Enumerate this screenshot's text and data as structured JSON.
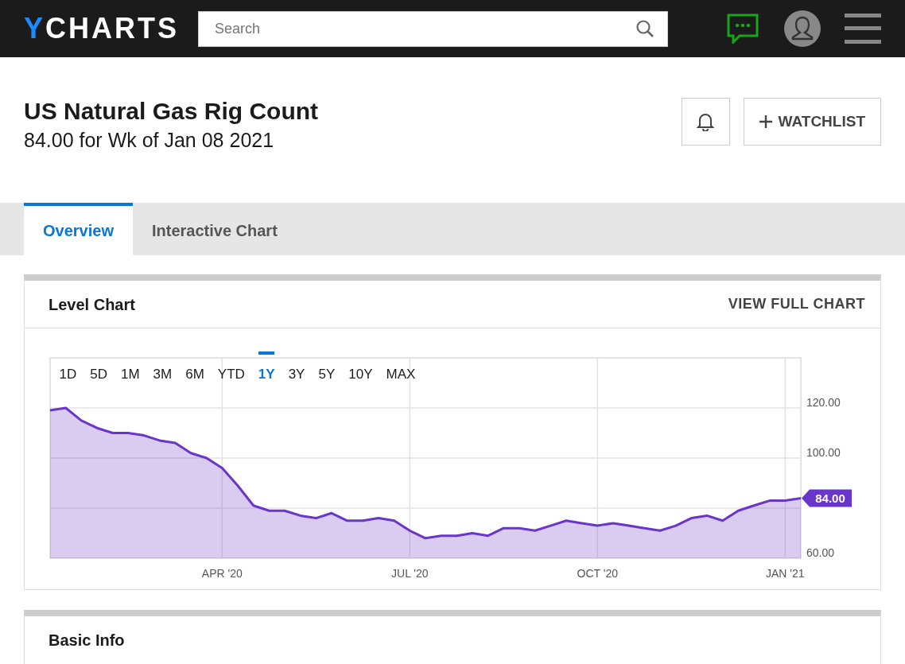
{
  "navbar": {
    "logo": "YCHARTS",
    "search": {
      "placeholder": "Search"
    }
  },
  "header": {
    "title": "US Natural Gas Rig Count",
    "subtitle": "84.00 for Wk of Jan 08 2021",
    "watchlist_button": "WATCHLIST"
  },
  "tabs": [
    {
      "label": "Overview",
      "selected": true
    },
    {
      "label": "Interactive Chart",
      "selected": false
    }
  ],
  "level_chart": {
    "title": "Level Chart",
    "link": "VIEW FULL CHART",
    "ranges": [
      {
        "label": "1D",
        "selected": false
      },
      {
        "label": "5D",
        "selected": false
      },
      {
        "label": "1M",
        "selected": false
      },
      {
        "label": "3M",
        "selected": false
      },
      {
        "label": "6M",
        "selected": false
      },
      {
        "label": "YTD",
        "selected": false
      },
      {
        "label": "1Y",
        "selected": true
      },
      {
        "label": "3Y",
        "selected": false
      },
      {
        "label": "5Y",
        "selected": false
      },
      {
        "label": "10Y",
        "selected": false
      },
      {
        "label": "MAX",
        "selected": false
      }
    ],
    "current_value_tag": "84.00",
    "chart_data": {
      "type": "area",
      "categories": [
        null,
        null,
        null,
        null,
        null,
        null,
        null,
        null,
        null,
        null,
        null,
        "APR '20",
        null,
        null,
        null,
        null,
        null,
        null,
        null,
        null,
        null,
        null,
        null,
        "JUL '20",
        null,
        null,
        null,
        null,
        null,
        null,
        null,
        null,
        null,
        null,
        null,
        "OCT '20",
        null,
        null,
        null,
        null,
        null,
        null,
        null,
        null,
        null,
        null,
        null,
        "JAN '21",
        null
      ],
      "grid": true,
      "series": [
        {
          "color": "#6a35c9",
          "values": [
            119,
            120,
            115,
            112,
            110,
            110,
            109,
            107,
            106,
            102,
            100,
            96,
            89,
            81,
            79,
            79,
            77,
            76,
            78,
            75,
            75,
            76,
            75,
            71,
            68,
            69,
            69,
            70,
            69,
            72,
            72,
            71,
            73,
            75,
            74,
            73,
            74,
            73,
            72,
            71,
            73,
            76,
            77,
            75,
            79,
            81,
            83,
            83,
            84
          ]
        }
      ],
      "ylim": [
        60,
        140
      ],
      "yticks": [
        {
          "value": 60,
          "label": "60.00"
        },
        {
          "value": 100,
          "label": "100.00"
        },
        {
          "value": 120,
          "label": "120.00"
        }
      ]
    }
  },
  "basic_info": {
    "title": "Basic Info"
  }
}
